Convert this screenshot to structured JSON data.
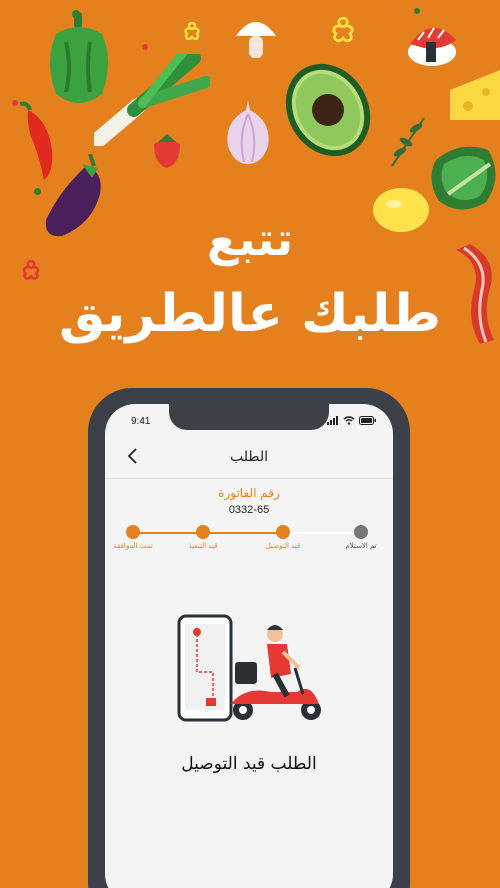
{
  "headline": {
    "line1": "تتبع",
    "line2": "طلبك عالطريق"
  },
  "colors": {
    "background": "#E5801F",
    "accent": "#E5801F",
    "phone_frame": "#3b4049",
    "inactive_step": "#777777"
  },
  "decorations": [
    "bell-pepper-icon",
    "mushroom-icon",
    "sushi-icon",
    "chili-pepper-icon",
    "leek-icon",
    "onion-icon",
    "avocado-icon",
    "cheese-icon",
    "strawberry-icon",
    "eggplant-icon",
    "lemon-icon",
    "lettuce-icon",
    "bacon-icon",
    "herb-icon"
  ],
  "phone": {
    "status_time": "9:41",
    "page_title": "الطلب",
    "invoice_label": "رقم الفاتورة",
    "invoice_number": "0332-65",
    "steps": [
      {
        "label": "تمت الموافقة",
        "active": true
      },
      {
        "label": "قيد التنفيذ",
        "active": true
      },
      {
        "label": "قيد التوصيل",
        "active": true
      },
      {
        "label": "تم الاستلام",
        "active": false
      }
    ],
    "status_message": "الطلب قيد التوصيل",
    "illustration": "delivery-scooter-icon"
  }
}
